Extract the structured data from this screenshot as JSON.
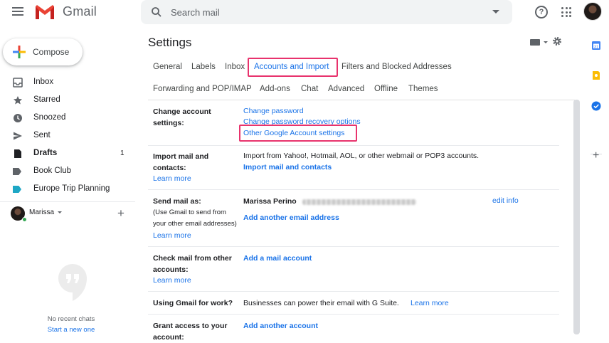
{
  "header": {
    "app_name": "Gmail",
    "search_placeholder": "Search mail",
    "help_icon_glyph": "?",
    "icons": [
      "menu-icon",
      "gmail-logo",
      "search-icon",
      "search-options-caret",
      "help-icon",
      "apps-icon",
      "account-avatar"
    ]
  },
  "sidebar": {
    "compose_label": "Compose",
    "items": [
      {
        "label": "Inbox",
        "icon": "inbox-icon",
        "count": ""
      },
      {
        "label": "Starred",
        "icon": "star-icon",
        "count": ""
      },
      {
        "label": "Snoozed",
        "icon": "clock-icon",
        "count": ""
      },
      {
        "label": "Sent",
        "icon": "send-icon",
        "count": ""
      },
      {
        "label": "Drafts",
        "icon": "draft-icon",
        "count": "1"
      },
      {
        "label": "Book Club",
        "icon": "label-icon",
        "count": ""
      },
      {
        "label": "Europe Trip Planning",
        "icon": "label-icon",
        "count": ""
      }
    ],
    "label_colors": {
      "book_club": "#5f6368",
      "europe_trip": "#1ea7c5"
    },
    "user_name": "Marissa",
    "add_chat_glyph": "+",
    "no_chats_text": "No recent chats",
    "start_chat_link": "Start a new one"
  },
  "main": {
    "title": "Settings",
    "tabs_row1": [
      "General",
      "Labels",
      "Inbox",
      "Accounts and Import",
      "Filters and Blocked Addresses"
    ],
    "tabs_row2": [
      "Forwarding and POP/IMAP",
      "Add-ons",
      "Chat",
      "Advanced",
      "Offline",
      "Themes"
    ],
    "active_tab": "Accounts and Import",
    "highlight_color": "#e8336d",
    "sections": {
      "change_account": {
        "label": "Change account settings:",
        "links": [
          "Change password",
          "Change password recovery options",
          "Other Google Account settings"
        ]
      },
      "import_mail": {
        "label": "Import mail and contacts:",
        "learn_more": "Learn more",
        "text": "Import from Yahoo!, Hotmail, AOL, or other webmail or POP3 accounts.",
        "link": "Import mail and contacts"
      },
      "send_mail_as": {
        "label": "Send mail as:",
        "sub": "(Use Gmail to send from your other email addresses)",
        "learn_more": "Learn more",
        "name": "Marissa Perino",
        "edit_link": "edit info",
        "link": "Add another email address"
      },
      "check_mail": {
        "label": "Check mail from other accounts:",
        "learn_more": "Learn more",
        "link": "Add a mail account"
      },
      "gmail_work": {
        "label": "Using Gmail for work?",
        "text": "Businesses can power their email with G Suite.",
        "link": "Learn more"
      },
      "grant_access": {
        "label": "Grant access to your account:",
        "link": "Add another account"
      }
    }
  },
  "right_panel": {
    "icons": [
      "calendar-icon",
      "keep-icon",
      "tasks-icon",
      "add-addon-icon"
    ],
    "add_glyph": "+"
  }
}
